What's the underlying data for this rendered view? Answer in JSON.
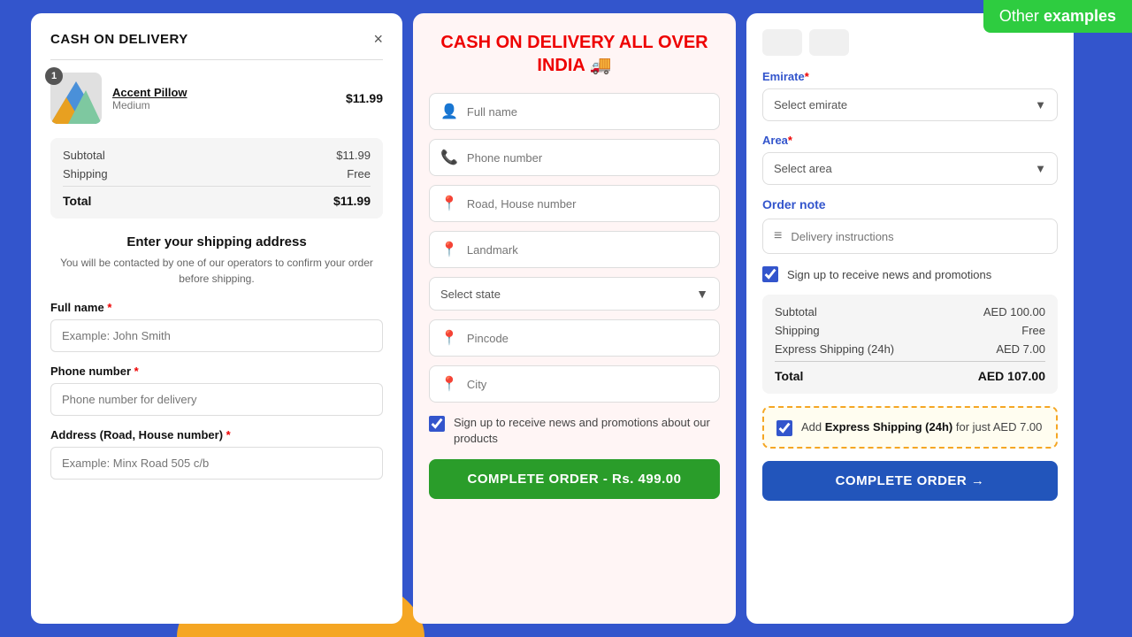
{
  "badge": {
    "text_normal": "Other ",
    "text_bold": "examples"
  },
  "left_panel": {
    "title": "CASH ON DELIVERY",
    "close_label": "×",
    "product": {
      "name": "Accent Pillow",
      "variant": "Medium",
      "price": "$11.99",
      "badge_count": "1"
    },
    "price_table": {
      "subtotal_label": "Subtotal",
      "subtotal_value": "$11.99",
      "shipping_label": "Shipping",
      "shipping_value": "Free",
      "total_label": "Total",
      "total_value": "$11.99"
    },
    "address_section": {
      "title": "Enter your shipping address",
      "subtitle": "You will be contacted by one of our operators to confirm your order before shipping.",
      "full_name_label": "Full name",
      "full_name_placeholder": "Example: John Smith",
      "phone_label": "Phone number",
      "phone_placeholder": "Phone number for delivery",
      "address_label": "Address (Road, House number)",
      "address_placeholder": "Example: Minx Road 505 c/b"
    }
  },
  "middle_panel": {
    "title": "CASH ON DELIVERY ALL OVER INDIA 🚚",
    "full_name_placeholder": "Full name",
    "phone_placeholder": "Phone number",
    "road_placeholder": "Road, House number",
    "landmark_placeholder": "Landmark",
    "state_placeholder": "Select state",
    "pincode_placeholder": "Pincode",
    "city_placeholder": "City",
    "checkbox_label": "Sign up to receive news and promotions about our products",
    "complete_btn": "COMPLETE ORDER - Rs. 499.00"
  },
  "right_panel": {
    "emirate_label": "Emirate",
    "emirate_required": "*",
    "emirate_placeholder": "Select emirate",
    "area_label": "Area",
    "area_required": "*",
    "area_placeholder": "Select area",
    "order_note_label": "Order note",
    "delivery_placeholder": "Delivery instructions",
    "signup_label": "Sign up to receive news and promotions",
    "price_table": {
      "subtotal_label": "Subtotal",
      "subtotal_value": "AED 100.00",
      "shipping_label": "Shipping",
      "shipping_value": "Free",
      "express_label": "Express Shipping (24h)",
      "express_value": "AED 7.00",
      "total_label": "Total",
      "total_value": "AED 107.00"
    },
    "express_banner": {
      "text_prefix": "Add ",
      "text_bold": "Express Shipping (24h)",
      "text_suffix": " for just AED 7.00"
    },
    "complete_btn": "COMPLETE ORDER →"
  }
}
